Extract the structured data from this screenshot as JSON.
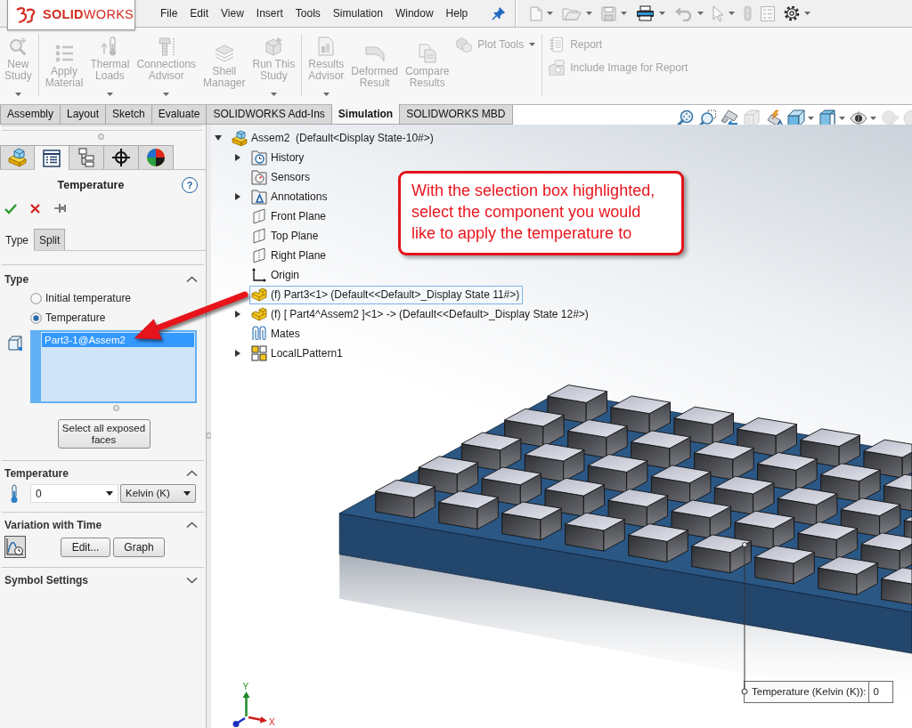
{
  "title_bar": {
    "logo": "**SOLID**WORKS",
    "menu": [
      "File",
      "Edit",
      "View",
      "Insert",
      "Tools",
      "Simulation",
      "Window",
      "Help"
    ],
    "quick_access": [
      {
        "kind": "new",
        "caret": true,
        "disabled": true
      },
      {
        "kind": "open",
        "caret": true,
        "disabled": true
      },
      {
        "kind": "save",
        "caret": true,
        "disabled": true
      },
      {
        "kind": "print",
        "caret": true,
        "disabled": false
      },
      {
        "kind": "undo",
        "caret": true,
        "disabled": true
      },
      {
        "kind": "select",
        "caret": true,
        "disabled": true
      },
      {
        "kind": "rebuild",
        "caret": false,
        "disabled": true
      },
      {
        "kind": "properties",
        "caret": false,
        "disabled": true
      },
      {
        "kind": "options",
        "caret": true,
        "disabled": false
      }
    ]
  },
  "ribbon": {
    "groups": [
      {
        "commands": [
          {
            "kind": "new-study",
            "label": "New\nStudy",
            "caret": true,
            "disabled": true
          }
        ]
      },
      {
        "commands": [
          {
            "kind": "apply-material",
            "label": "Apply\nMaterial",
            "caret": false,
            "disabled": true
          },
          {
            "kind": "thermal-loads",
            "label": "Thermal\nLoads",
            "caret": true,
            "disabled": true
          },
          {
            "kind": "connections-advisor",
            "label": "Connections\nAdvisor",
            "caret": true,
            "disabled": true
          },
          {
            "kind": "shell-manager",
            "label": "Shell\nManager",
            "caret": false,
            "disabled": true
          },
          {
            "kind": "run-study",
            "label": "Run This\nStudy",
            "caret": true,
            "disabled": true
          }
        ]
      },
      {
        "commands": [
          {
            "kind": "results-advisor",
            "label": "Results\nAdvisor",
            "caret": true,
            "disabled": true
          },
          {
            "kind": "deformed-result",
            "label": "Deformed\nResult",
            "caret": false,
            "disabled": true
          },
          {
            "kind": "compare-results",
            "label": "Compare\nResults",
            "caret": false,
            "disabled": true
          }
        ],
        "stacked": [
          {
            "kind": "plot-tools",
            "label": "Plot Tools",
            "caret": true,
            "disabled": true
          }
        ]
      },
      {
        "stacked": [
          {
            "kind": "report",
            "label": "Report",
            "caret": false,
            "disabled": true
          },
          {
            "kind": "include-image",
            "label": "Include Image for Report",
            "caret": false,
            "disabled": true
          }
        ]
      }
    ]
  },
  "command_tabs": [
    {
      "label": "Assembly",
      "selected": false
    },
    {
      "label": "Layout",
      "selected": false
    },
    {
      "label": "Sketch",
      "selected": false
    },
    {
      "label": "Evaluate",
      "selected": false
    },
    {
      "label": "SOLIDWORKS Add-Ins",
      "selected": false
    },
    {
      "label": "Simulation",
      "selected": true
    },
    {
      "label": "SOLIDWORKS MBD",
      "selected": false
    }
  ],
  "view_toolbar": [
    {
      "kind": "zoom-fit",
      "caret": false,
      "disabled": false
    },
    {
      "kind": "zoom-area",
      "caret": false,
      "disabled": false
    },
    {
      "kind": "previous-view",
      "caret": false,
      "disabled": false
    },
    {
      "kind": "section-view",
      "caret": false,
      "disabled": true
    },
    {
      "kind": "dynamic-annotation",
      "caret": false,
      "disabled": false
    },
    {
      "kind": "view-orientation",
      "caret": true,
      "disabled": false
    },
    {
      "kind": "display-style",
      "caret": true,
      "disabled": false
    },
    {
      "kind": "hide-show",
      "caret": true,
      "disabled": false
    },
    {
      "kind": "edit-appearance",
      "caret": false,
      "disabled": true
    },
    {
      "kind": "scene",
      "caret": false,
      "disabled": true
    }
  ],
  "property_manager": {
    "tabs": [
      {
        "kind": "feature-manager",
        "selected": false
      },
      {
        "kind": "property-manager",
        "selected": true
      },
      {
        "kind": "configuration-manager",
        "selected": false
      },
      {
        "kind": "dimxpert",
        "selected": false
      },
      {
        "kind": "display-manager",
        "selected": false
      }
    ],
    "title": "Temperature",
    "help": "?",
    "subtabs": [
      {
        "label": "Type",
        "selected": true
      },
      {
        "label": "Split",
        "selected": false
      }
    ],
    "sections": [
      {
        "kind": "type",
        "title": "Type",
        "expanded": true,
        "options": [
          {
            "label": "Initial temperature",
            "selected": false
          },
          {
            "label": "Temperature",
            "selected": true
          }
        ],
        "selection": {
          "active": true,
          "items": [
            {
              "label": "Part3-1@Assem2",
              "selected": true
            }
          ]
        },
        "button": "Select all exposed faces"
      },
      {
        "kind": "temperature",
        "title": "Temperature",
        "expanded": true,
        "value": "0",
        "unit": "Kelvin (K)"
      },
      {
        "kind": "variation",
        "title": "Variation with Time",
        "expanded": true,
        "buttons": [
          "Edit...",
          "Graph"
        ]
      },
      {
        "kind": "symbol",
        "title": "Symbol Settings",
        "expanded": false
      }
    ]
  },
  "feature_tree": {
    "items": [
      {
        "kind": "assembly",
        "label": "Assem2  (Default<Display State-10#>)",
        "expanded": true,
        "selected": false,
        "children": [
          {
            "kind": "history",
            "label": "History",
            "expanded": false,
            "selected": false
          },
          {
            "kind": "sensors",
            "label": "Sensors",
            "selected": false
          },
          {
            "kind": "annotations",
            "label": "Annotations",
            "expanded": false,
            "selected": false
          },
          {
            "kind": "plane",
            "label": "Front Plane",
            "selected": false
          },
          {
            "kind": "plane",
            "label": "Top Plane",
            "selected": false
          },
          {
            "kind": "plane",
            "label": "Right Plane",
            "selected": false
          },
          {
            "kind": "origin",
            "label": "Origin",
            "selected": false
          },
          {
            "kind": "part",
            "label": "(f) Part3<1> (Default<<Default>_Display State 11#>)",
            "selected": true
          },
          {
            "kind": "part",
            "label": "(f) [ Part4^Assem2 ]<1> -> (Default<<Default>_Display State 12#>)",
            "expanded": false,
            "selected": false
          },
          {
            "kind": "mates",
            "label": "Mates",
            "selected": false
          },
          {
            "kind": "pattern",
            "label": "LocalLPattern1",
            "expanded": false,
            "selected": false
          }
        ]
      }
    ]
  },
  "callout": {
    "text": "With the selection box highlighted, select the component you would like to apply the temperature to"
  },
  "temperature_tag": {
    "label": "Temperature (Kelvin (K)):",
    "value": "0"
  },
  "triad": {
    "x_label": "X",
    "y_label": "Y"
  }
}
